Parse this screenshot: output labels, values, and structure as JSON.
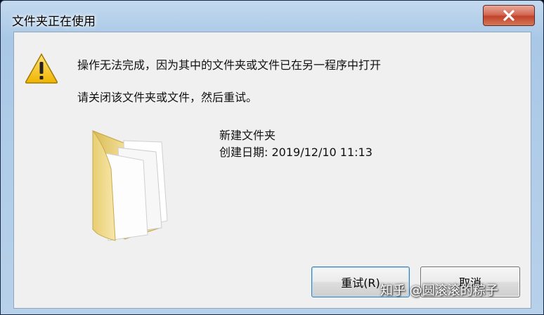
{
  "dialog": {
    "title": "文件夹正在使用",
    "message_line1": "操作无法完成，因为其中的文件夹或文件已在另一程序中打开",
    "message_line2": "请关闭该文件夹或文件，然后重试。",
    "warning_icon": "warning-triangle-icon",
    "close_icon": "close-x-icon"
  },
  "file": {
    "icon": "folder-icon",
    "name": "新建文件夹",
    "created": "创建日期: 2019/12/10 11:13"
  },
  "buttons": {
    "retry_label": "重试(R)",
    "cancel_label": "取消"
  },
  "watermark": "知乎 @圆滚滚的粽子",
  "colors": {
    "title_bar": "#b8d1ea",
    "close_button": "#c0432c",
    "client_bg": "#f0f0f0",
    "warning_yellow": "#f5c518",
    "folder_yellow": "#e9d27a"
  }
}
